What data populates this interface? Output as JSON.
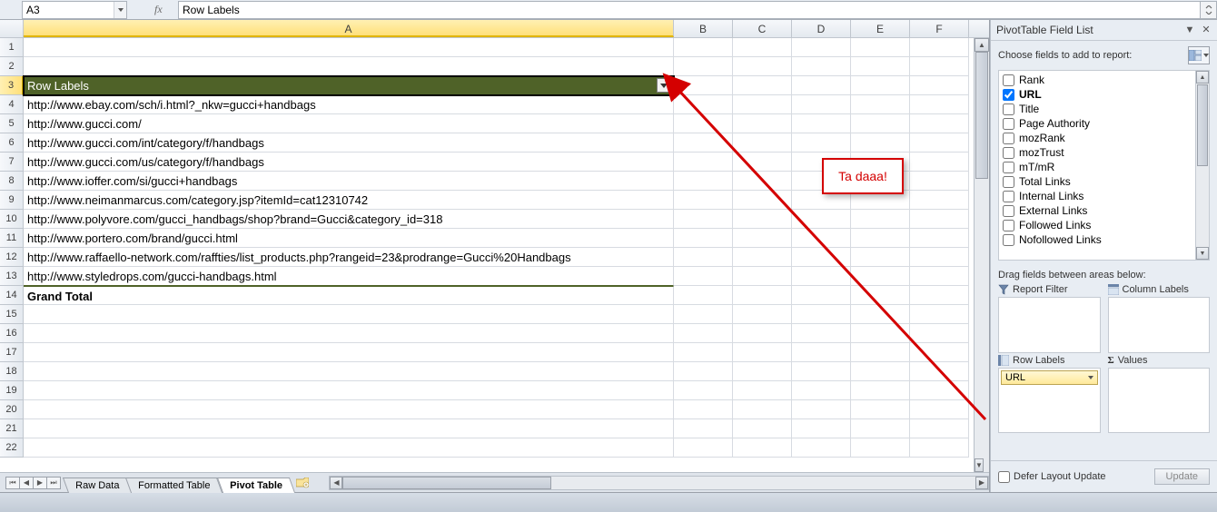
{
  "formula_bar": {
    "name_box": "A3",
    "formula": "Row Labels"
  },
  "columns": [
    "A",
    "B",
    "C",
    "D",
    "E",
    "F"
  ],
  "row_numbers": [
    1,
    2,
    3,
    4,
    5,
    6,
    7,
    8,
    9,
    10,
    11,
    12,
    13,
    14,
    15,
    16,
    17,
    18,
    19,
    20,
    21,
    22
  ],
  "pivot": {
    "header": "Row Labels",
    "rows": [
      "http://www.ebay.com/sch/i.html?_nkw=gucci+handbags",
      "http://www.gucci.com/",
      "http://www.gucci.com/int/category/f/handbags",
      "http://www.gucci.com/us/category/f/handbags",
      "http://www.ioffer.com/si/gucci+handbags",
      "http://www.neimanmarcus.com/category.jsp?itemId=cat12310742",
      "http://www.polyvore.com/gucci_handbags/shop?brand=Gucci&category_id=318",
      "http://www.portero.com/brand/gucci.html",
      "http://www.raffaello-network.com/raffties/list_products.php?rangeid=23&prodrange=Gucci%20Handbags",
      "http://www.styledrops.com/gucci-handbags.html"
    ],
    "grand_total": "Grand Total"
  },
  "annotation": "Ta daaa!",
  "sheet_tabs": {
    "tabs": [
      "Raw Data",
      "Formatted Table",
      "Pivot Table"
    ],
    "active": "Pivot Table"
  },
  "pane": {
    "title": "PivotTable Field List",
    "choose_label": "Choose fields to add to report:",
    "fields": [
      {
        "name": "Rank",
        "checked": false
      },
      {
        "name": "URL",
        "checked": true
      },
      {
        "name": "Title",
        "checked": false
      },
      {
        "name": "Page Authority",
        "checked": false
      },
      {
        "name": "mozRank",
        "checked": false
      },
      {
        "name": "mozTrust",
        "checked": false
      },
      {
        "name": "mT/mR",
        "checked": false
      },
      {
        "name": "Total Links",
        "checked": false
      },
      {
        "name": "Internal Links",
        "checked": false
      },
      {
        "name": "External Links",
        "checked": false
      },
      {
        "name": "Followed Links",
        "checked": false
      },
      {
        "name": "Nofollowed Links",
        "checked": false
      }
    ],
    "drag_label": "Drag fields between areas below:",
    "areas": {
      "report_filter": "Report Filter",
      "column_labels": "Column Labels",
      "row_labels": "Row Labels",
      "values": "Values",
      "row_item": "URL"
    },
    "defer_label": "Defer Layout Update",
    "update_btn": "Update"
  },
  "col_widths": {
    "A": 716,
    "other": 65
  }
}
